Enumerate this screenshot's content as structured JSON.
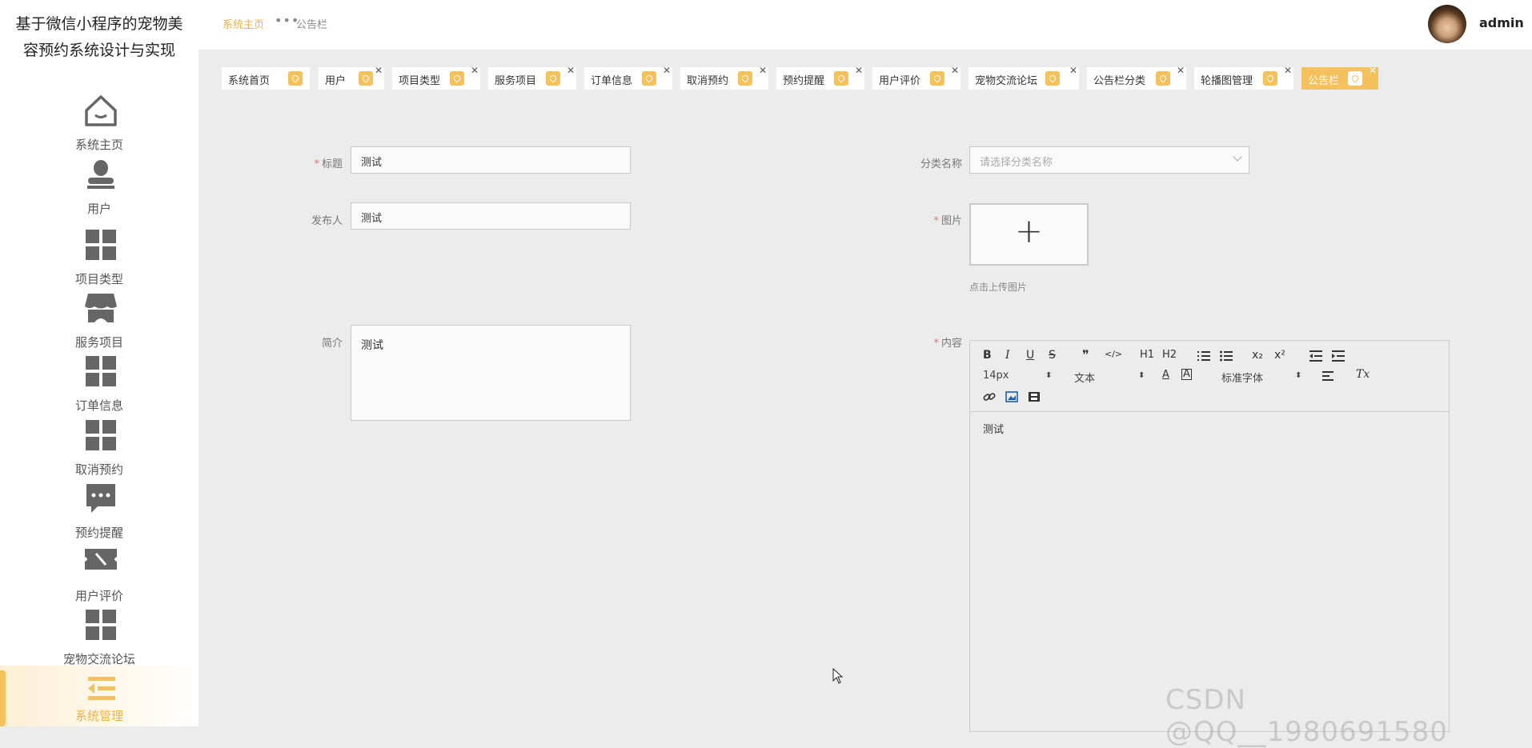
{
  "app": {
    "title": "基于微信小程序的宠物美容预约系统设计与实现"
  },
  "sidebar": {
    "items": [
      {
        "label": "系统主页",
        "icon": "home-icon"
      },
      {
        "label": "用户",
        "icon": "user-icon"
      },
      {
        "label": "项目类型",
        "icon": "grid-icon"
      },
      {
        "label": "服务项目",
        "icon": "shop-icon"
      },
      {
        "label": "订单信息",
        "icon": "grid-icon"
      },
      {
        "label": "取消预约",
        "icon": "grid-icon"
      },
      {
        "label": "预约提醒",
        "icon": "chat-icon"
      },
      {
        "label": "用户评价",
        "icon": "ticket-icon"
      },
      {
        "label": "宠物交流论坛",
        "icon": "grid-icon"
      },
      {
        "label": "系统管理",
        "icon": "menu-icon",
        "active": true
      }
    ]
  },
  "breadcrumb": {
    "home": "系统主页",
    "sep": "•••",
    "current": "公告栏"
  },
  "user": {
    "name": "admin"
  },
  "tabs": [
    {
      "label": "系统首页"
    },
    {
      "label": "用户"
    },
    {
      "label": "项目类型"
    },
    {
      "label": "服务项目"
    },
    {
      "label": "订单信息"
    },
    {
      "label": "取消预约"
    },
    {
      "label": "预约提醒"
    },
    {
      "label": "用户评价"
    },
    {
      "label": "宠物交流论坛"
    },
    {
      "label": "公告栏分类"
    },
    {
      "label": "轮播图管理"
    },
    {
      "label": "公告栏",
      "active": true
    }
  ],
  "form": {
    "title": {
      "label": "标题",
      "value": "测试",
      "required": "*"
    },
    "publisher": {
      "label": "发布人",
      "value": "测试"
    },
    "category": {
      "label": "分类名称",
      "placeholder": "请选择分类名称"
    },
    "image": {
      "label": "图片",
      "required": "*",
      "plus": "+",
      "tip": "点击上传图片"
    },
    "summary": {
      "label": "简介",
      "value": "测试"
    },
    "content": {
      "label": "内容",
      "required": "*",
      "toolbar": {
        "bold": "B",
        "italic": "I",
        "underline": "U",
        "strike": "S",
        "quote": "❞",
        "code": "</>",
        "h1": "H1",
        "h2": "H2",
        "sub": "x₂",
        "sup": "x²",
        "size": "14px",
        "type": "文本",
        "font": "标准字体",
        "clear": "Tx"
      },
      "value": "测试"
    }
  },
  "watermark": "CSDN @QQ__1980691580",
  "colors": {
    "accent": "#f5c15c",
    "accent_text": "#f0b144",
    "required": "#f56c6c"
  }
}
